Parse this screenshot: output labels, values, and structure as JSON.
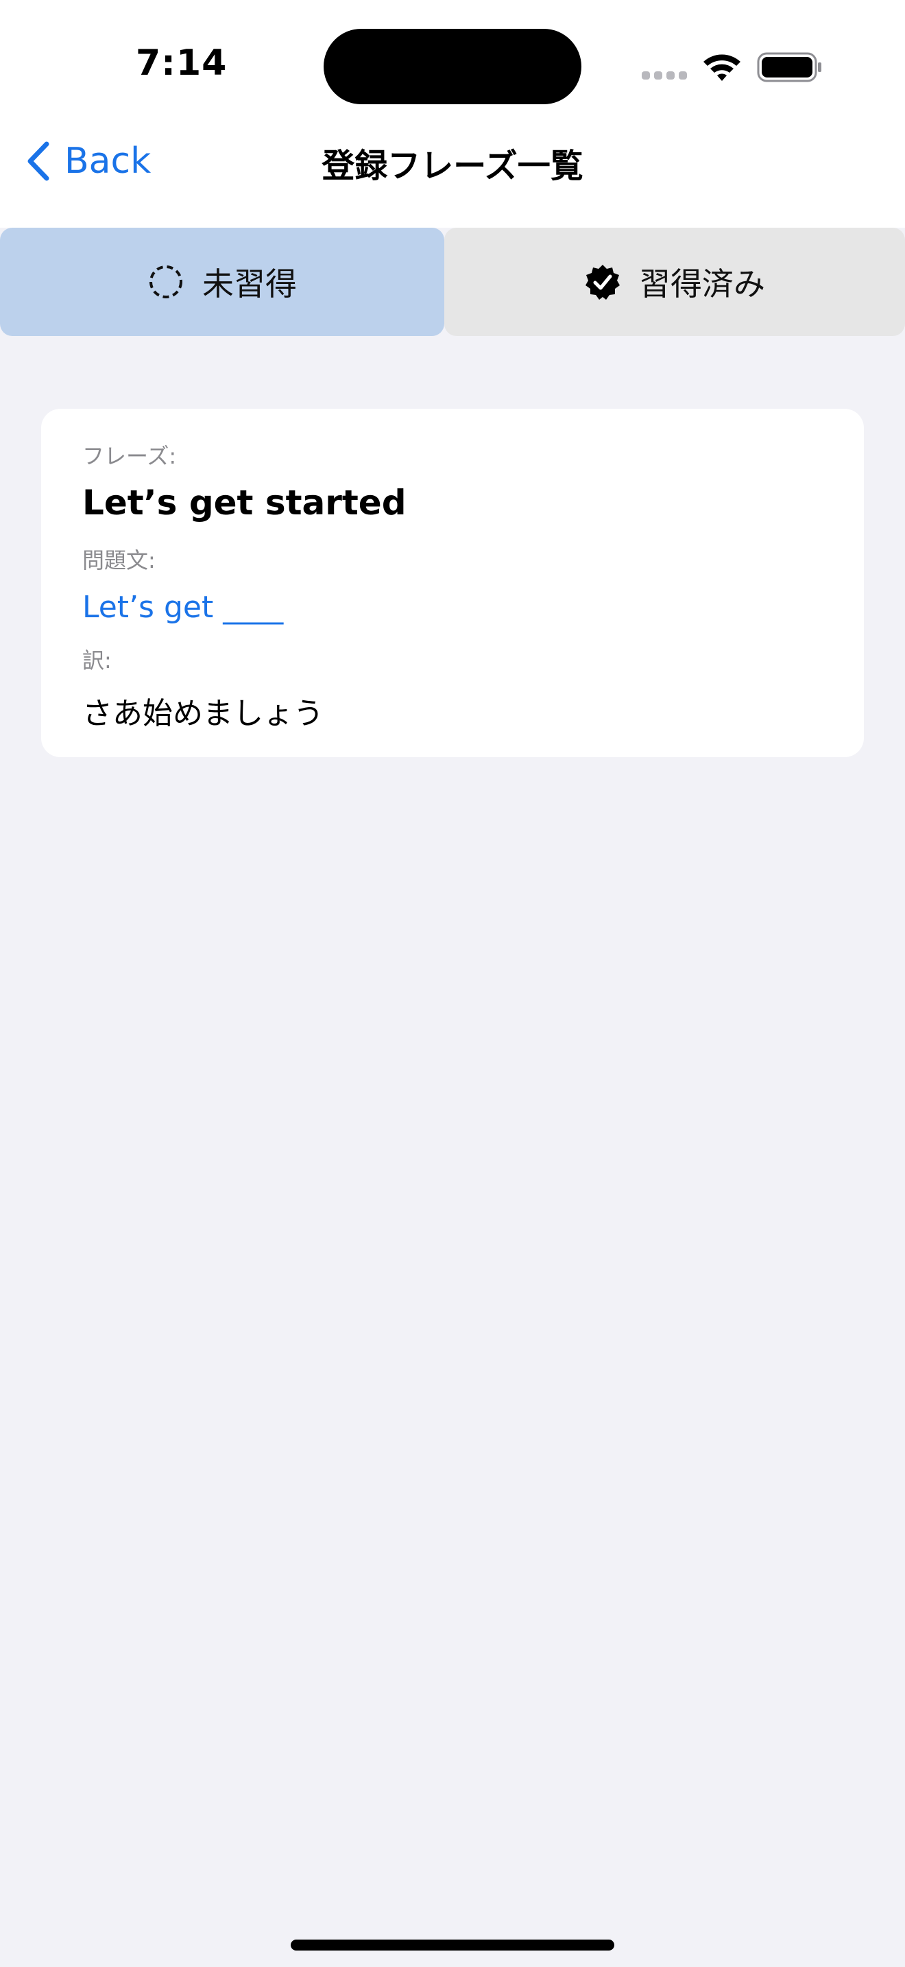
{
  "status_bar": {
    "time": "7:14"
  },
  "nav": {
    "back_label": "Back",
    "title": "登録フレーズ一覧"
  },
  "segments": [
    {
      "label": "未習得",
      "icon": "dashed-circle-icon",
      "selected": true
    },
    {
      "label": "習得済み",
      "icon": "checkmark-seal-icon",
      "selected": false
    }
  ],
  "card": {
    "phrase_label": "フレーズ:",
    "phrase": "Let’s get started",
    "question_label": "問題文:",
    "question": "Let’s get ____",
    "translation_label": "訳:",
    "translation": "さあ始めましょう"
  },
  "colors": {
    "accent": "#1a73e8",
    "background": "#f2f2f7",
    "segment_selected": "#bcd1ec",
    "segment_unselected": "#e6e6e6"
  }
}
